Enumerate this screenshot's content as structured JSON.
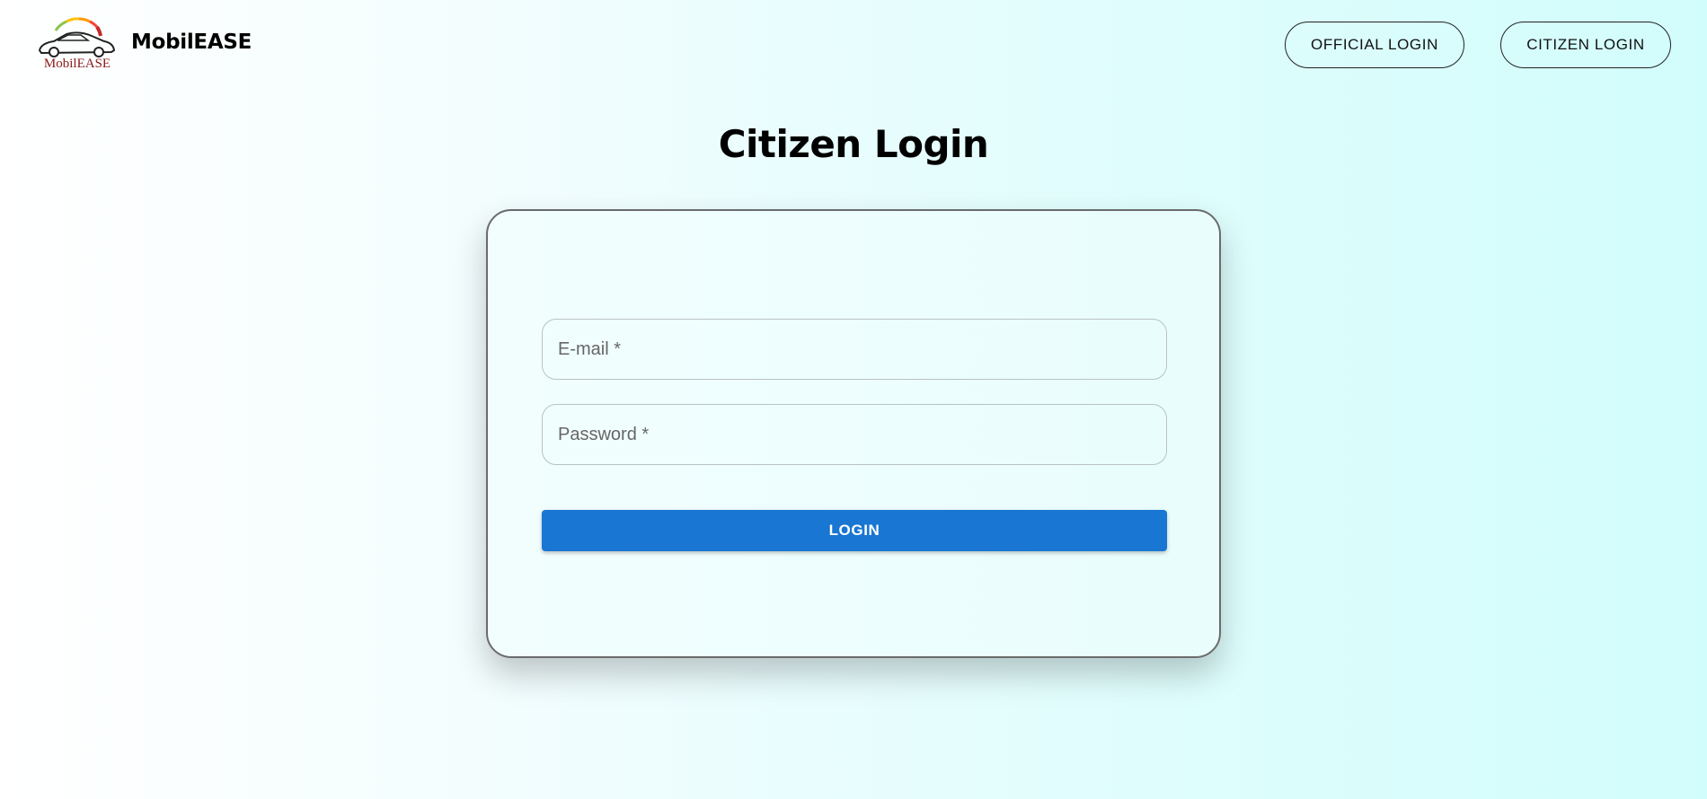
{
  "header": {
    "brand_name": "MobilEASE",
    "logo_text": "MobilEASE",
    "nav": {
      "official_login": "OFFICIAL LOGIN",
      "citizen_login": "CITIZEN LOGIN"
    }
  },
  "main": {
    "title": "Citizen Login",
    "form": {
      "email_placeholder": "E-mail *",
      "email_value": "",
      "password_placeholder": "Password *",
      "password_value": "",
      "submit_label": "LOGIN"
    }
  },
  "colors": {
    "primary_button": "#1976d2",
    "gauge": [
      "#8bc34a",
      "#ffc107",
      "#ff9800",
      "#f44336",
      "#c62828"
    ],
    "logo_text": "#8b1a1a"
  }
}
